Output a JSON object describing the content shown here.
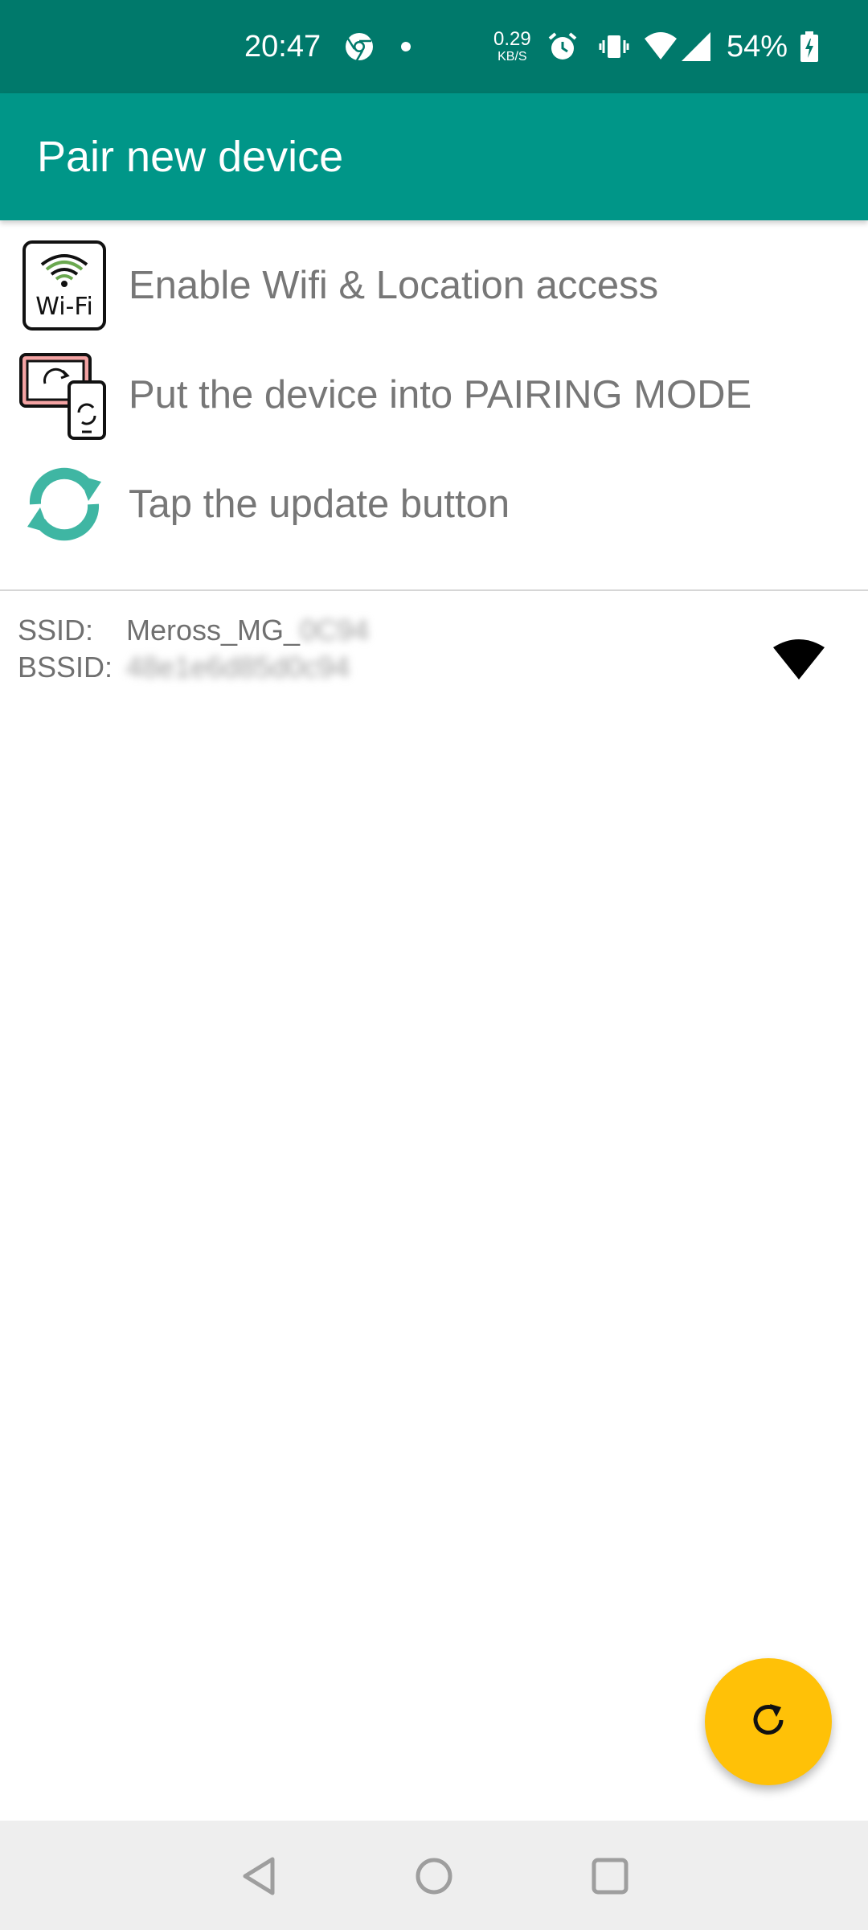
{
  "status_bar": {
    "time": "20:47",
    "net_speed_value": "0.29",
    "net_speed_unit": "KB/S",
    "battery_percent": "54%",
    "icons": [
      "chrome-icon",
      "notification-dot-icon",
      "alarm-icon",
      "vibrate-icon",
      "wifi-icon",
      "cell-signal-icon",
      "battery-charging-icon"
    ]
  },
  "app_bar": {
    "title": "Pair new device",
    "color": "#009688",
    "status_color": "#00796b"
  },
  "steps": [
    {
      "icon": "wifi-sign-icon",
      "label": "Enable Wifi & Location access"
    },
    {
      "icon": "device-pairing-icon",
      "label": "Put the device into PAIRING MODE"
    },
    {
      "icon": "update-arrows-icon",
      "label": "Tap the update button"
    }
  ],
  "network": {
    "ssid_label": "SSID:",
    "ssid_value": "Meross_MG_",
    "ssid_suffix_blurred": "0C94",
    "bssid_label": "BSSID:",
    "bssid_value_blurred": "48e1e6d85d0c94",
    "signal_icon": "wifi-signal-icon"
  },
  "fab": {
    "icon": "refresh-icon",
    "color": "#ffc107"
  },
  "nav_bar": {
    "buttons": [
      "back-icon",
      "home-icon",
      "recents-icon"
    ]
  }
}
